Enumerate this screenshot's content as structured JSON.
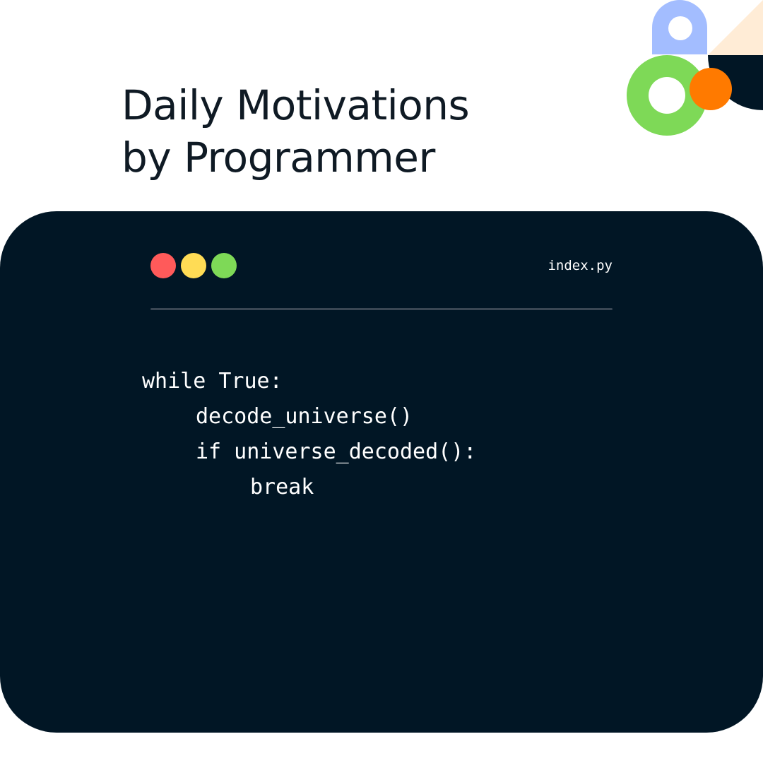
{
  "heading": {
    "line1": "Daily Motivations",
    "line2": "by Programmer"
  },
  "editor": {
    "filename": "index.py",
    "code_lines": [
      "while True:",
      "decode_universe()",
      "if universe_decoded():",
      "break"
    ],
    "window_controls": [
      "close-dot",
      "minimize-dot",
      "maximize-dot"
    ]
  },
  "colors": {
    "background": "#ffffff",
    "heading_text": "#0f1a24",
    "editor_background": "#011625",
    "editor_text": "#ffffff",
    "divider": "#3a4754",
    "dot_close": "#ff5a5a",
    "dot_minimize": "#ffdc55",
    "dot_maximize": "#7ed957",
    "deco_blue": "#a3bdff",
    "deco_cream": "#ffecd6",
    "deco_navy": "#011625",
    "deco_green": "#7ed957",
    "deco_orange": "#ff7a00"
  }
}
